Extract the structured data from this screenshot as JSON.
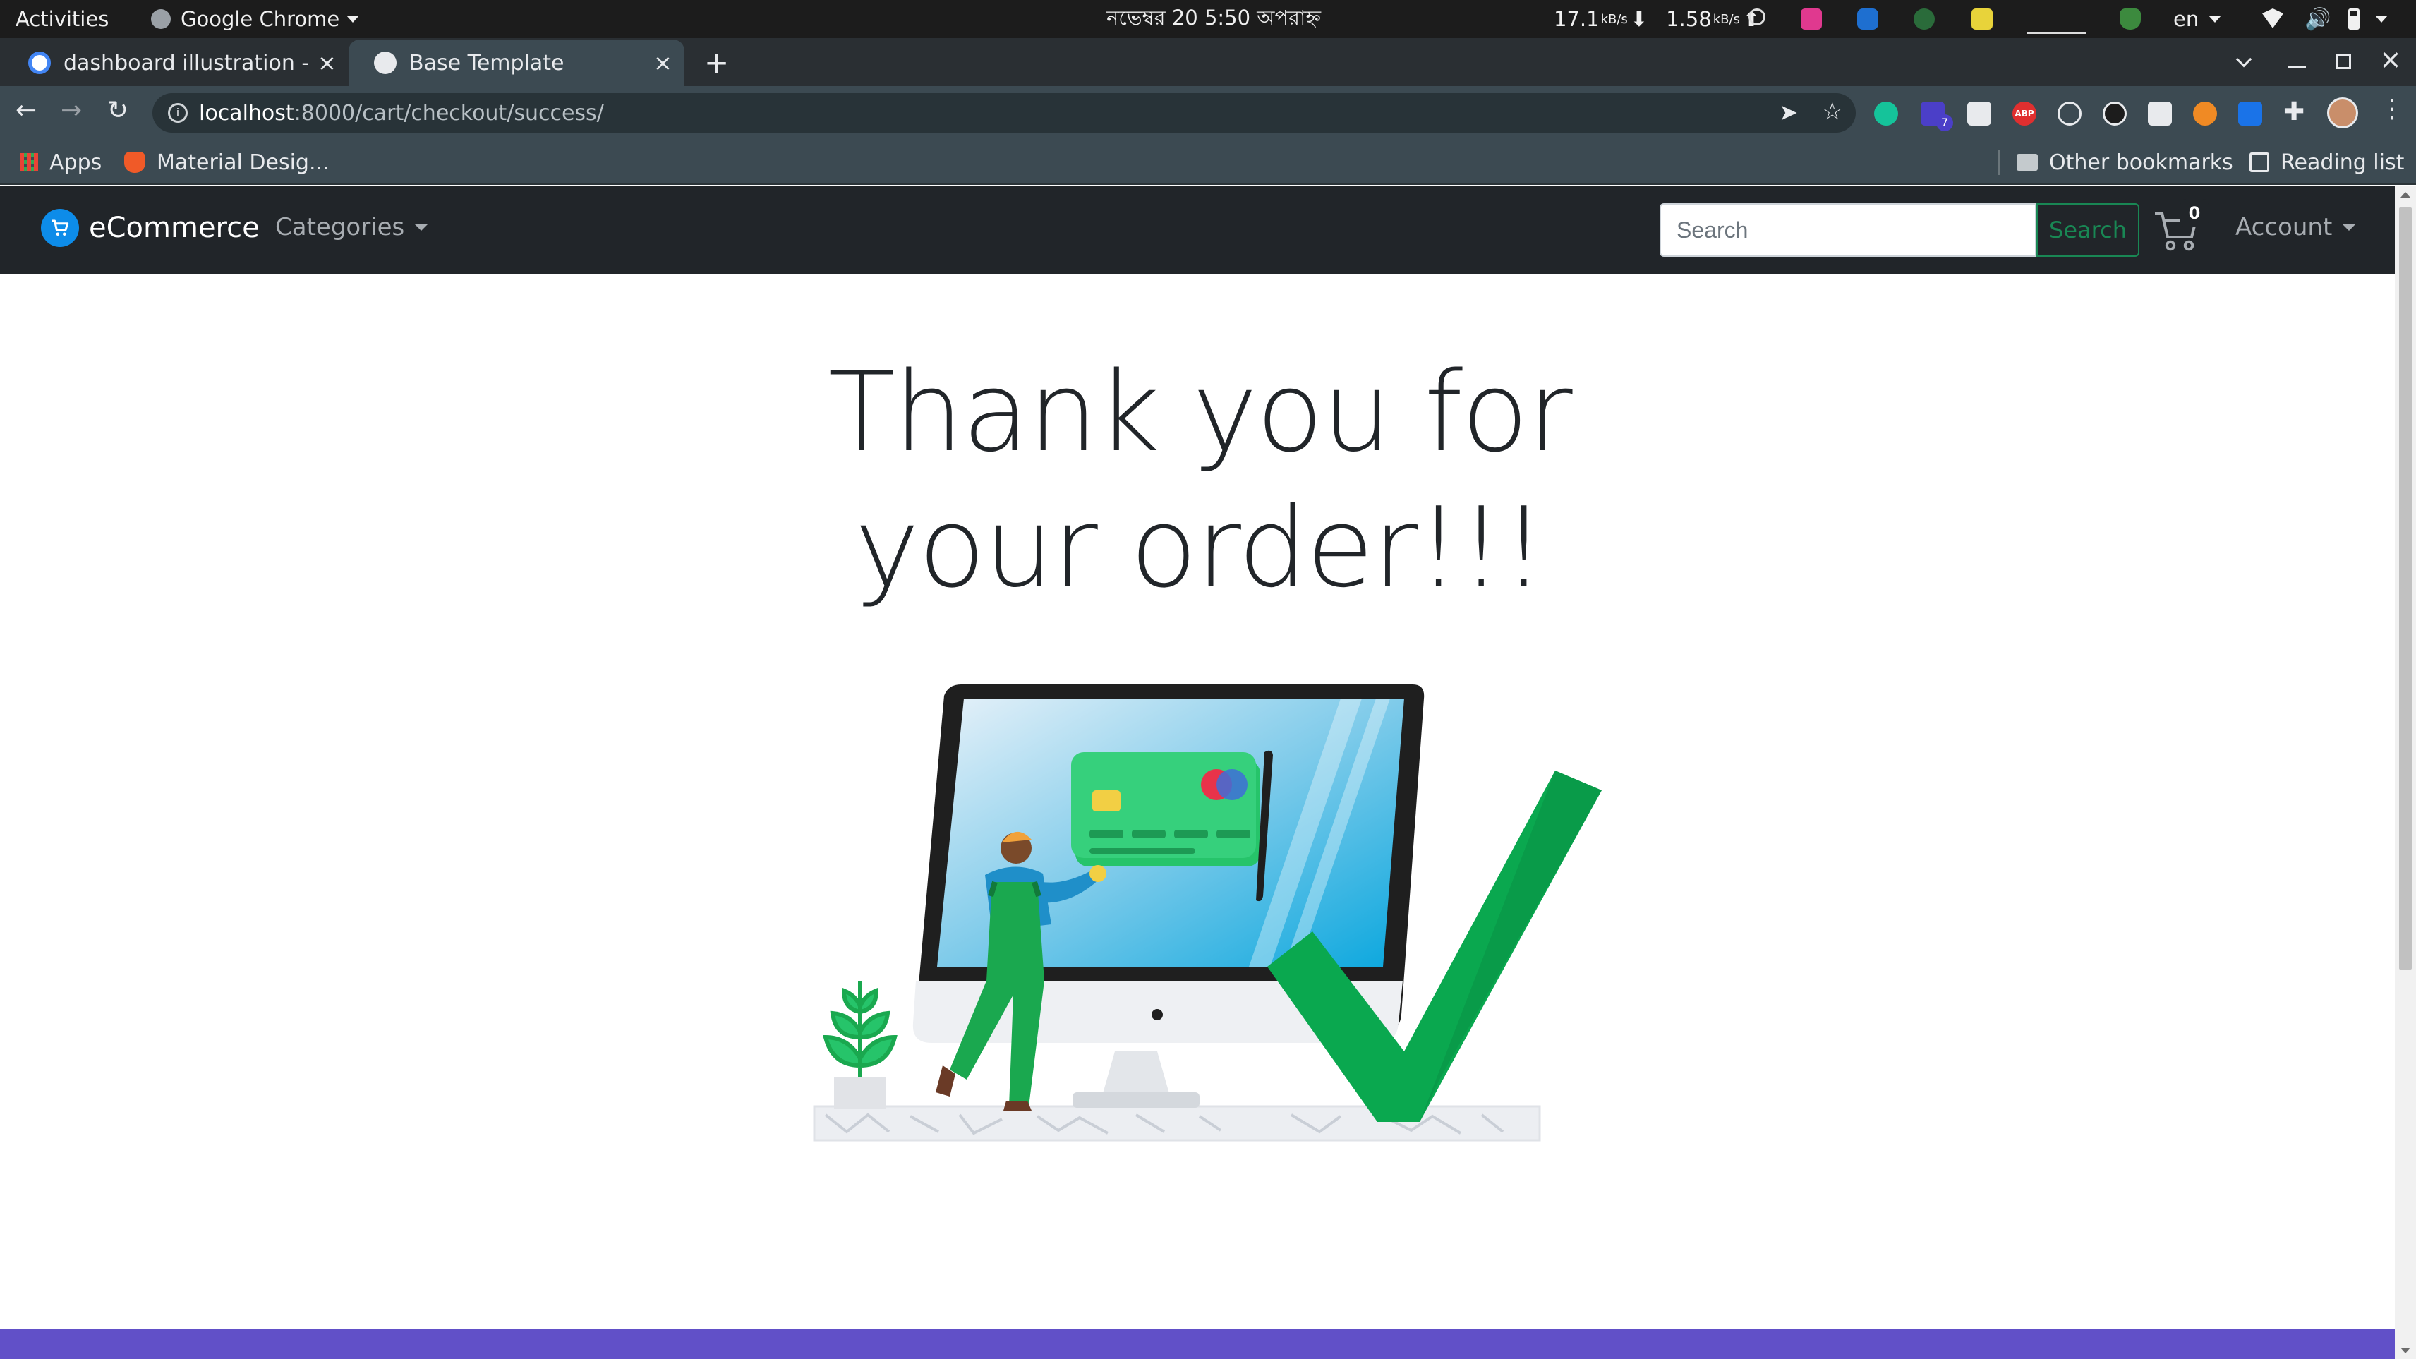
{
  "os": {
    "activities": "Activities",
    "app_name": "Google Chrome",
    "clock": "নভেম্বর 20   5:50 অপরাহ্ন",
    "net_down": "17.1",
    "net_down_unit": "kB/s",
    "net_up": "1.58",
    "net_up_unit": "kB/s",
    "language": "en"
  },
  "browser": {
    "tabs": [
      {
        "title": "dashboard illustration - G",
        "active": false
      },
      {
        "title": "Base Template",
        "active": true
      }
    ],
    "new_tab": "+",
    "url_host": "localhost",
    "url_path": ":8000/cart/checkout/success/",
    "bookmarks": {
      "apps": "Apps",
      "material": "Material Desig...",
      "other": "Other bookmarks",
      "reading": "Reading list"
    },
    "ext_badge": "7"
  },
  "site": {
    "brand": "eCommerce",
    "nav": {
      "categories": "Categories",
      "account": "Account"
    },
    "search": {
      "placeholder": "Search",
      "button": "Search"
    },
    "cart_count": "0"
  },
  "main": {
    "heading_line1": "Thank you for",
    "heading_line2": "your order!!!",
    "illustration": "order-success-illustration"
  },
  "colors": {
    "navbar": "#212529",
    "brand_icon": "#0d8ce9",
    "search_accent": "#198754",
    "footer": "#6150c8",
    "check_green": "#0aa84f"
  }
}
